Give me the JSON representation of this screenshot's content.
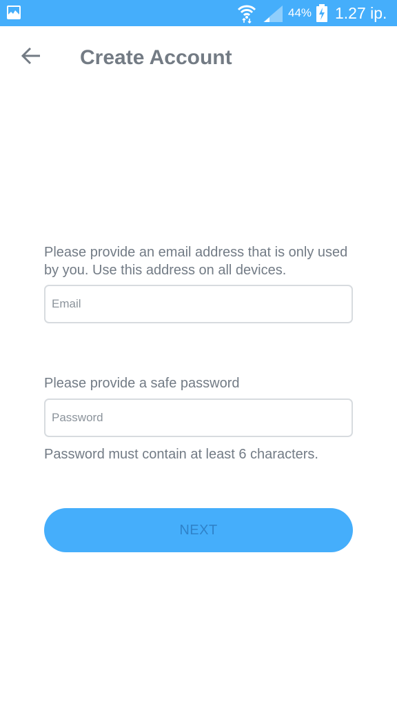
{
  "status_bar": {
    "battery": "44%",
    "time": "1.27 ip.",
    "icons": [
      "gallery-icon",
      "wifi-icon",
      "signal-icon",
      "battery-charging-icon"
    ]
  },
  "header": {
    "back_icon": "arrow-left-icon",
    "title": "Create Account"
  },
  "form": {
    "email_prompt": "Please provide an email address that is only used by you. Use this address on all devices.",
    "email": {
      "placeholder": "Email",
      "value": ""
    },
    "password_prompt": "Please provide a safe password",
    "password": {
      "placeholder": "Password",
      "value": ""
    },
    "password_hint": "Password must contain at least 6 characters.",
    "next_label": "NEXT"
  },
  "colors": {
    "accent": "#45aefb",
    "title_text": "#737b84",
    "body_text": "#727b85",
    "field_border": "#d7dbdf",
    "button_text": "#2f82c9"
  }
}
